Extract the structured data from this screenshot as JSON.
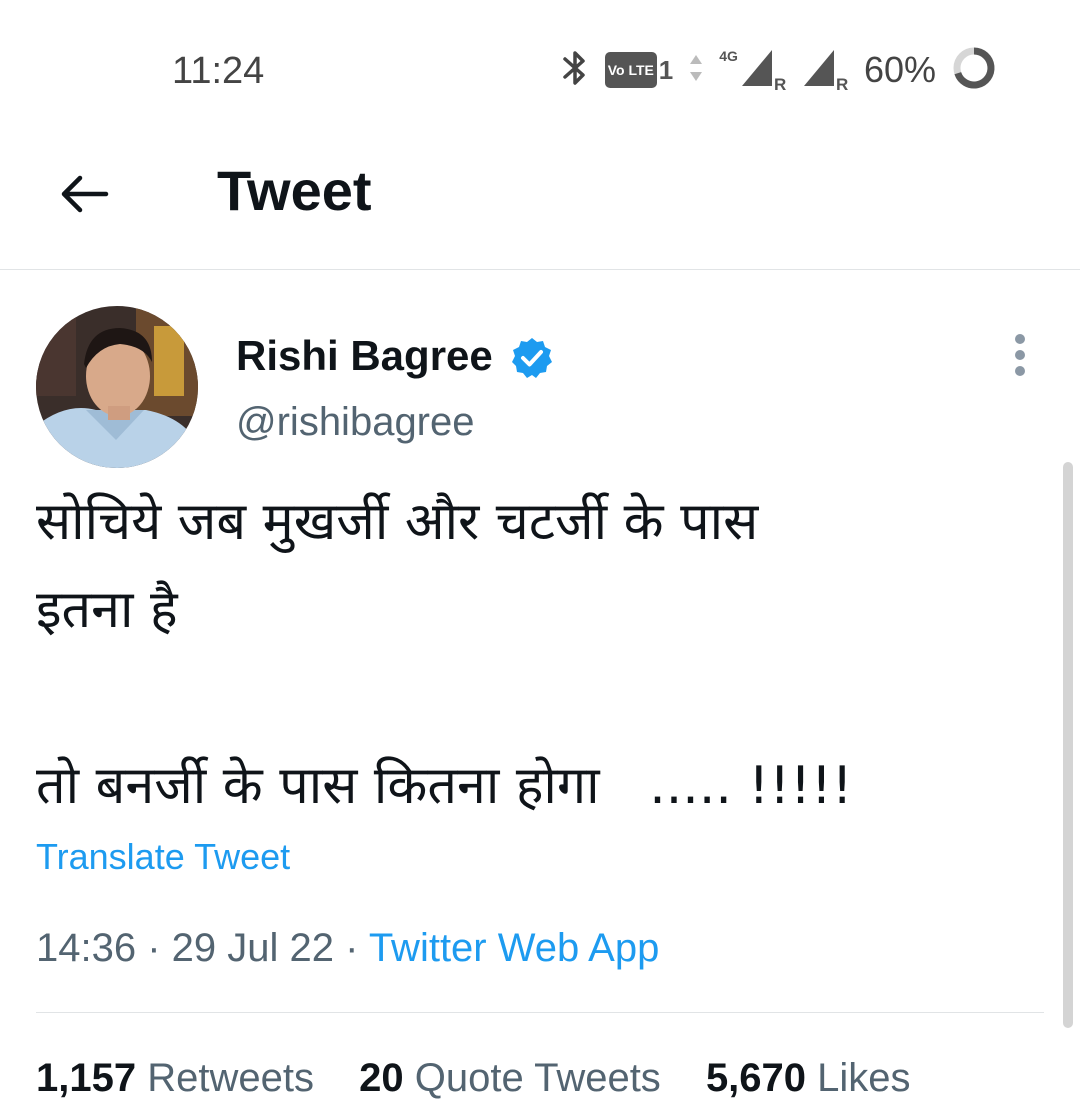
{
  "status_bar": {
    "time": "11:24",
    "volte": "Vo LTE",
    "sim": "1",
    "network": "4G",
    "roaming_mark": "R",
    "battery": "60%",
    "icons": [
      "bluetooth-icon",
      "volte-icon",
      "signal-icon",
      "signal-icon",
      "battery-ring-icon"
    ]
  },
  "header": {
    "back_icon": "arrow-left-icon",
    "title": "Tweet"
  },
  "tweet": {
    "author_name": "Rishi Bagree",
    "verified_icon": "verified-badge-icon",
    "handle": "@rishibagree",
    "more_icon": "vertical-dots-icon",
    "text_lines": [
      "सोचिये जब मुखर्जी और चटर्जी के पास",
      "इतना है",
      "",
      "तो बनर्जी के पास कितना होगा   ..... !!!!!"
    ],
    "translate_label": "Translate Tweet",
    "time": "14:36",
    "separator": " · ",
    "date": "29 Jul 22",
    "source": "Twitter Web App",
    "stats": {
      "retweets_count": "1,157",
      "retweets_label": "Retweets",
      "quotes_count": "20",
      "quotes_label": "Quote Tweets",
      "likes_count": "5,670",
      "likes_label": "Likes"
    }
  },
  "colors": {
    "link": "#1d9bf0",
    "secondary_text": "#536471",
    "primary_text": "#0f1419",
    "divider": "#e1e4e6"
  }
}
